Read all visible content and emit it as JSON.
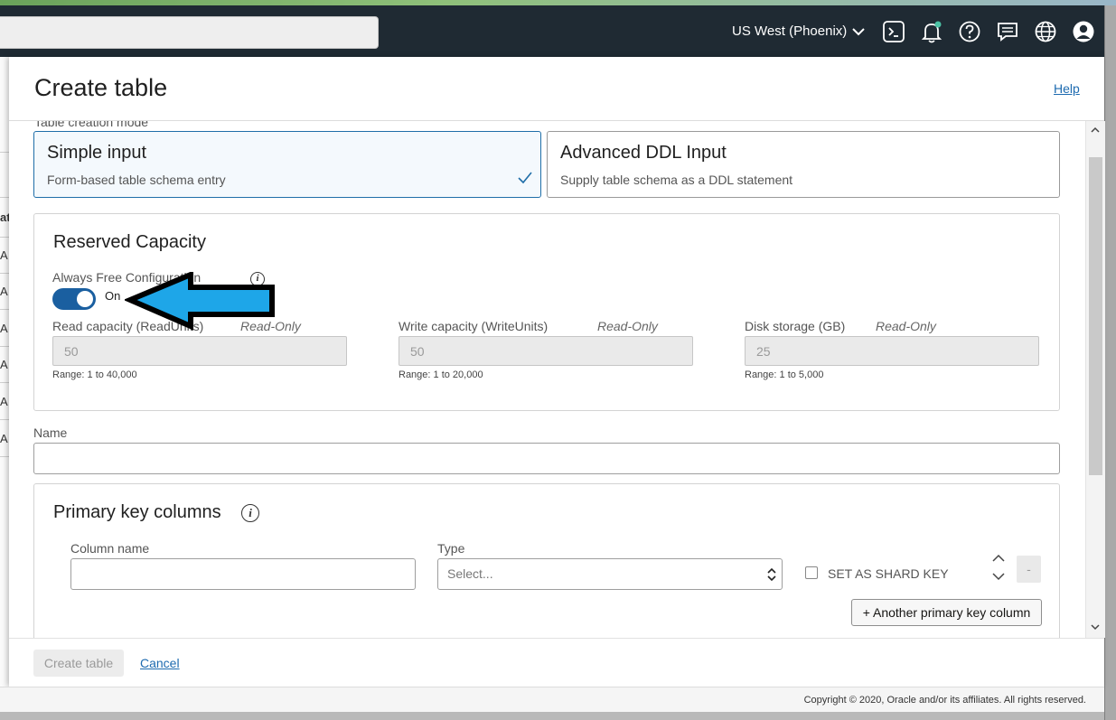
{
  "header": {
    "region_label": "US West (Phoenix)",
    "icons": [
      "cloud-shell-icon",
      "bell-icon",
      "help-icon",
      "chat-icon",
      "globe-icon",
      "user-icon"
    ]
  },
  "background_list": {
    "rows": [
      "at",
      "A",
      "A",
      "A",
      "A",
      "A",
      "A"
    ]
  },
  "panel": {
    "title": "Create table",
    "help_link": "Help",
    "creation_mode": {
      "label": "Table creation mode",
      "options": [
        {
          "title": "Simple input",
          "description": "Form-based table schema entry",
          "selected": true
        },
        {
          "title": "Advanced DDL Input",
          "description": "Supply table schema as a DDL statement",
          "selected": false
        }
      ]
    },
    "reserved_capacity": {
      "title": "Reserved Capacity",
      "always_free_label": "Always Free Configuration",
      "toggle_state": "On",
      "toggle_on": true,
      "fields": [
        {
          "label": "Read capacity (ReadUnits)",
          "tag": "Read-Only",
          "value": "50",
          "range": "Range: 1 to 40,000"
        },
        {
          "label": "Write capacity (WriteUnits)",
          "tag": "Read-Only",
          "value": "50",
          "range": "Range: 1 to 20,000"
        },
        {
          "label": "Disk storage (GB)",
          "tag": "Read-Only",
          "value": "25",
          "range": "Range: 1 to 5,000"
        }
      ]
    },
    "name": {
      "label": "Name",
      "value": ""
    },
    "primary_key": {
      "title": "Primary key columns",
      "column_name_label": "Column name",
      "column_name_value": "",
      "type_label": "Type",
      "type_placeholder": "Select...",
      "shard_key_label": "SET AS SHARD KEY",
      "shard_key_checked": false,
      "remove_button": "-",
      "add_button": "+ Another primary key column"
    },
    "footer": {
      "create_button": "Create table",
      "cancel_link": "Cancel"
    }
  },
  "copyright": "Copyright © 2020, Oracle and/or its affiliates. All rights reserved.",
  "colors": {
    "header_bg": "#1f2a33",
    "link": "#1e6bb0",
    "toggle_on": "#1a5fa0",
    "annotation_arrow": "#1ea6e8"
  }
}
